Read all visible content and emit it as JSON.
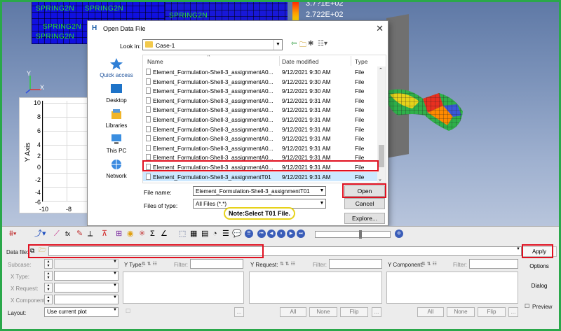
{
  "graphics": {
    "spring_labels": [
      "SPRING2N",
      "SPRING2N",
      "SPRING2N",
      "SPRING2N",
      "SPRING2N"
    ],
    "legend_values": [
      "3.7?1E+02",
      "2.722E+02"
    ]
  },
  "axis_triad": {
    "y": "Y",
    "x": "X"
  },
  "plot": {
    "ylabel": "Y Axis",
    "yticks": [
      "10",
      "8",
      "6",
      "4",
      "2",
      "0",
      "-2",
      "-4",
      "-6"
    ],
    "xticks": [
      "-10",
      "-8"
    ]
  },
  "dialog": {
    "title": "Open Data File",
    "look_in_label": "Look in:",
    "look_in_value": "Case-1",
    "places": [
      "Quick access",
      "Desktop",
      "Libraries",
      "This PC",
      "Network"
    ],
    "columns": {
      "name": "Name",
      "date": "Date modified",
      "type": "Type"
    },
    "files": [
      {
        "name": "Element_Formulation-Shell-3_assignmentA0...",
        "date": "9/12/2021 9:30 AM",
        "type": "File"
      },
      {
        "name": "Element_Formulation-Shell-3_assignmentA0...",
        "date": "9/12/2021 9:30 AM",
        "type": "File"
      },
      {
        "name": "Element_Formulation-Shell-3_assignmentA0...",
        "date": "9/12/2021 9:30 AM",
        "type": "File"
      },
      {
        "name": "Element_Formulation-Shell-3_assignmentA0...",
        "date": "9/12/2021 9:31 AM",
        "type": "File"
      },
      {
        "name": "Element_Formulation-Shell-3_assignmentA0...",
        "date": "9/12/2021 9:31 AM",
        "type": "File"
      },
      {
        "name": "Element_Formulation-Shell-3_assignmentA0...",
        "date": "9/12/2021 9:31 AM",
        "type": "File"
      },
      {
        "name": "Element_Formulation-Shell-3_assignmentA0...",
        "date": "9/12/2021 9:31 AM",
        "type": "File"
      },
      {
        "name": "Element_Formulation-Shell-3_assignmentA0...",
        "date": "9/12/2021 9:31 AM",
        "type": "File"
      },
      {
        "name": "Element_Formulation-Shell-3_assignmentA0...",
        "date": "9/12/2021 9:31 AM",
        "type": "File"
      },
      {
        "name": "Element_Formulation-Shell-3_assignmentA0...",
        "date": "9/12/2021 9:31 AM",
        "type": "File"
      },
      {
        "name": "Element_Formulation-Shell-3_assignmentA0...",
        "date": "9/12/2021 9:31 AM",
        "type": "File"
      },
      {
        "name": "Element_Formulation-Shell-3_assignmentT01",
        "date": "9/12/2021 9:31 AM",
        "type": "File"
      }
    ],
    "file_name_label": "File name:",
    "file_name_value": "Element_Formulation-Shell-3_assignmentT01",
    "file_type_label": "Files of type:",
    "file_type_value": "All Files (*.*)",
    "open_label": "Open",
    "cancel_label": "Cancel",
    "explore_label": "Explore...",
    "note": "Note:Select T01 File."
  },
  "panel": {
    "data_file_label": "Data file:",
    "apply_label": "Apply",
    "options_label": "Options",
    "dialog_label": "Dialog",
    "preview_label": "Preview",
    "subcase_label": "Subcase:",
    "xtype_label": "X Type:",
    "xrequest_label": "X Request:",
    "xcomponent_label": "X Component:",
    "layout_label": "Layout:",
    "layout_value": "Use current plot",
    "ytype_label": "Y Type:",
    "yrequest_label": "Y Request:",
    "ycomponent_label": "Y Component:",
    "filter_label": "Filter:",
    "all_label": "All",
    "none_label": "None",
    "flip_label": "Flip",
    "more_label": "..."
  },
  "colors": {
    "highlight_border": "#e01020",
    "frame_border": "#2aa84a",
    "note_border": "#e7d21a"
  }
}
